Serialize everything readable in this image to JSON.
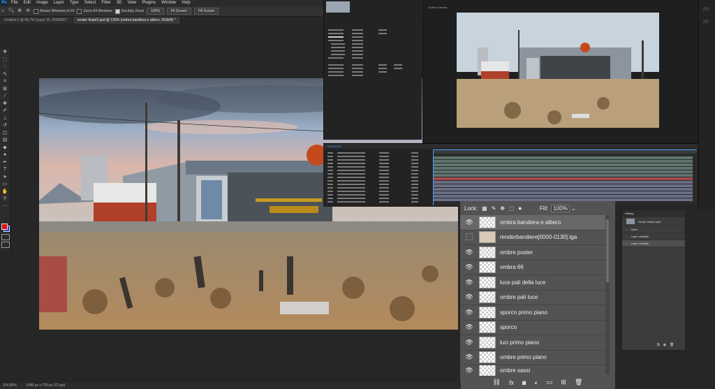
{
  "menubar": {
    "app_icon": "Ps",
    "items": [
      "File",
      "Edit",
      "Image",
      "Layer",
      "Type",
      "Select",
      "Filter",
      "3D",
      "View",
      "Plugins",
      "Window",
      "Help"
    ]
  },
  "options": {
    "resize_windows": "Resize Windows to Fit",
    "zoom_all_windows": "Zoom All Windows",
    "scrubby_zoom": "Scrubby Zoom",
    "zoom_value": "100%",
    "fit_screen": "Fit Screen",
    "fill_screen": "Fill Screen"
  },
  "tabs": [
    {
      "label": "Untitled-1 @ 66,7% (Layer 20, RGB/8#) *",
      "active": false
    },
    {
      "label": "render finale2.psd @ 125% (ombra bandiera e albero, RGB/8) *",
      "active": true
    }
  ],
  "status": {
    "zoom": "124,83%",
    "doc": "1086 px x 720 px (72 ppi)"
  },
  "ae": {
    "viewer_label": "Active Camera",
    "timecode": "0;00;00;00"
  },
  "layers": {
    "lock_label": "Lock:",
    "fill_label": "Fill:",
    "fill_value": "100%",
    "items": [
      {
        "name": "ombra bandiera e albero",
        "visible": true,
        "selected": true
      },
      {
        "name": "renderbandiere[0000-0130].tga",
        "visible": false,
        "selected": false
      },
      {
        "name": "ombre poster",
        "visible": true,
        "selected": false
      },
      {
        "name": "ombra 66",
        "visible": true,
        "selected": false
      },
      {
        "name": "luce pali della luce",
        "visible": true,
        "selected": false
      },
      {
        "name": "ombre pali luce",
        "visible": true,
        "selected": false
      },
      {
        "name": "sporco primo piano",
        "visible": true,
        "selected": false
      },
      {
        "name": "sporco",
        "visible": true,
        "selected": false
      },
      {
        "name": "luci primo piano",
        "visible": true,
        "selected": false
      },
      {
        "name": "ombre primo piano",
        "visible": true,
        "selected": false
      },
      {
        "name": "ombre sassi",
        "visible": true,
        "selected": false
      }
    ]
  },
  "history": {
    "title": "History",
    "snapshot": "render finale2.psd",
    "items": [
      "Open",
      "Layer Visibility",
      "Layer Visibility"
    ]
  },
  "colors": {
    "foreground": "#e01010",
    "background": "#1d3fd8",
    "layer_panel": "#535353",
    "ae_timeline_accent": "#4aa3ff"
  }
}
